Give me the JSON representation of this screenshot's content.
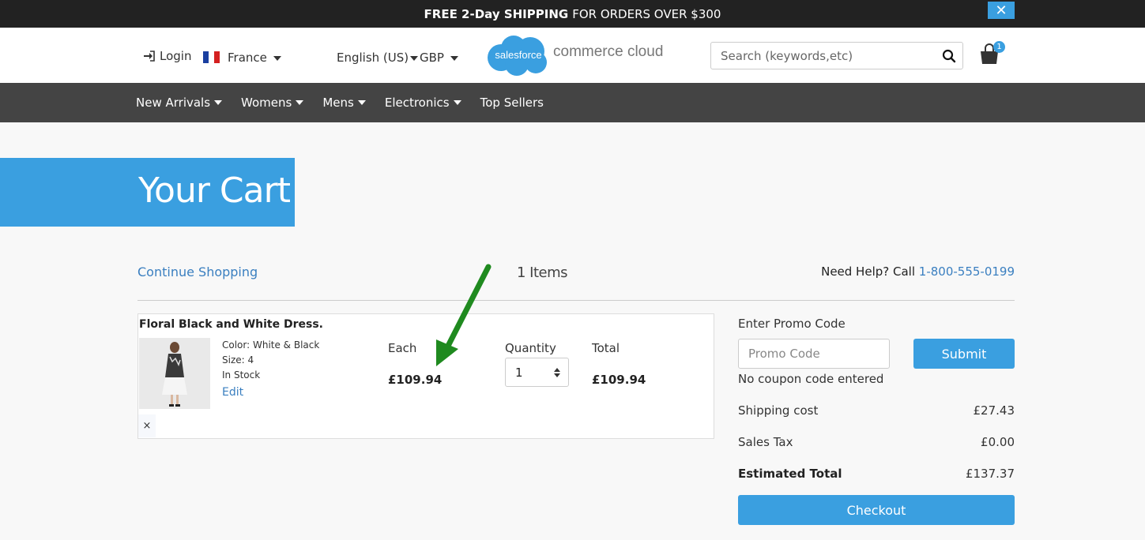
{
  "banner": {
    "bold_text": "FREE 2-Day SHIPPING",
    "text": "FOR ORDERS OVER $300",
    "close_label": "✕"
  },
  "header": {
    "login_label": "Login",
    "country": "France",
    "language": "English (US)",
    "currency": "GBP",
    "logo_cloud_text": "salesforce",
    "logo_text": "commerce cloud",
    "search_placeholder": "Search (keywords,etc)",
    "cart_count": "1"
  },
  "nav": {
    "items": [
      {
        "label": "New Arrivals",
        "dropdown": true
      },
      {
        "label": "Womens",
        "dropdown": true
      },
      {
        "label": "Mens",
        "dropdown": true
      },
      {
        "label": "Electronics",
        "dropdown": true
      },
      {
        "label": "Top Sellers",
        "dropdown": false
      }
    ]
  },
  "page": {
    "title": "Your Cart",
    "continue_label": "Continue Shopping",
    "items_count": "1 Items",
    "help_text": "Need Help? Call",
    "help_phone": "1-800-555-0199"
  },
  "cart_item": {
    "name": "Floral Black and White Dress.",
    "color": "Color: White & Black",
    "size": "Size: 4",
    "stock": "In Stock",
    "edit_label": "Edit",
    "each_label": "Each",
    "each_price": "£109.94",
    "quantity_label": "Quantity",
    "quantity": "1",
    "total_label": "Total",
    "total_price": "£109.94",
    "remove_label": "×"
  },
  "summary": {
    "promo_label": "Enter Promo Code",
    "promo_placeholder": "Promo Code",
    "submit_label": "Submit",
    "no_coupon": "No coupon code entered",
    "shipping_label": "Shipping cost",
    "shipping_value": "£27.43",
    "tax_label": "Sales Tax",
    "tax_value": "£0.00",
    "estimated_label": "Estimated Total",
    "estimated_value": "£137.37",
    "checkout_label": "Checkout"
  },
  "colors": {
    "accent": "#3a9fe0",
    "link": "#3a7fc0",
    "nav_bg": "#444444",
    "banner_bg": "#222222",
    "annotation_arrow": "#1f8a1f"
  }
}
